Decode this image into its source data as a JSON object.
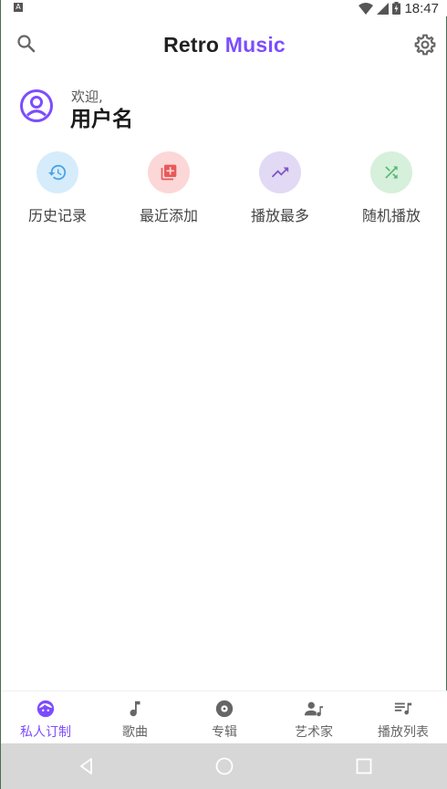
{
  "status_bar": {
    "notification_badge": "A",
    "time": "18:47",
    "icons": [
      "wifi-icon",
      "signal-icon",
      "battery-icon"
    ]
  },
  "toolbar": {
    "title_part1": "Retro",
    "title_part2": "Music",
    "accent_color": "#7c4dff",
    "icons": [
      "search-icon",
      "settings-gear-icon"
    ]
  },
  "user": {
    "greeting": "欢迎,",
    "name": "用户名"
  },
  "quick_actions": [
    {
      "label": "历史记录",
      "icon": "history-icon",
      "bg": "#d6ecfb",
      "fg": "#4aa3e8"
    },
    {
      "label": "最近添加",
      "icon": "library-add-icon",
      "bg": "#fcd7d7",
      "fg": "#e85a5a"
    },
    {
      "label": "播放最多",
      "icon": "trending-up-icon",
      "bg": "#e2d9f5",
      "fg": "#7e57c2"
    },
    {
      "label": "随机播放",
      "icon": "shuffle-icon",
      "bg": "#d6f0dc",
      "fg": "#58b870"
    }
  ],
  "bottom_nav": [
    {
      "label": "私人订制",
      "icon": "face-icon",
      "active": true
    },
    {
      "label": "歌曲",
      "icon": "music-note-icon",
      "active": false
    },
    {
      "label": "专辑",
      "icon": "album-icon",
      "active": false
    },
    {
      "label": "艺术家",
      "icon": "artist-icon",
      "active": false
    },
    {
      "label": "播放列表",
      "icon": "playlist-icon",
      "active": false
    }
  ],
  "system_nav": [
    "back-icon",
    "home-icon",
    "recents-icon"
  ]
}
